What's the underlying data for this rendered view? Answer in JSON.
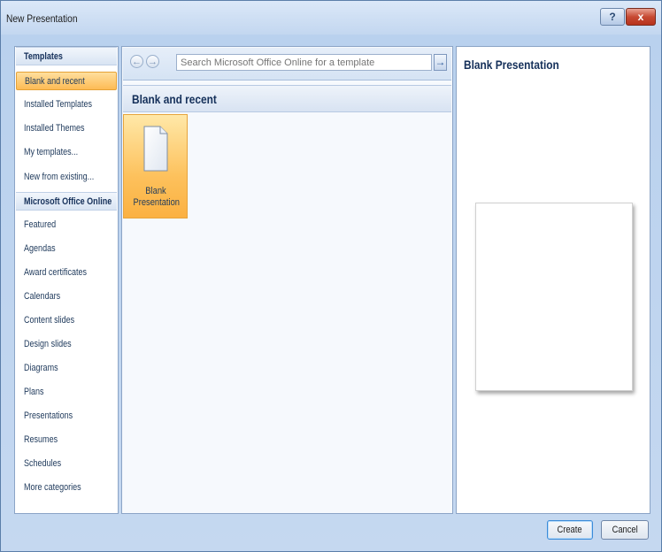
{
  "window": {
    "title": "New Presentation",
    "help_label": "?",
    "close_label": "x"
  },
  "sidebar": {
    "items": [
      {
        "label": "Templates",
        "kind": "header"
      },
      {
        "label": "Blank and recent",
        "kind": "selected"
      },
      {
        "label": "Installed Templates",
        "kind": "item"
      },
      {
        "label": "Installed Themes",
        "kind": "item"
      },
      {
        "label": "My templates...",
        "kind": "item"
      },
      {
        "label": "New from existing...",
        "kind": "item"
      },
      {
        "label": "Microsoft Office Online",
        "kind": "header"
      },
      {
        "label": "Featured",
        "kind": "item"
      },
      {
        "label": "Agendas",
        "kind": "item"
      },
      {
        "label": "Award certificates",
        "kind": "item"
      },
      {
        "label": "Calendars",
        "kind": "item"
      },
      {
        "label": "Content slides",
        "kind": "item"
      },
      {
        "label": "Design slides",
        "kind": "item"
      },
      {
        "label": "Diagrams",
        "kind": "item"
      },
      {
        "label": "Plans",
        "kind": "item"
      },
      {
        "label": "Presentations",
        "kind": "item"
      },
      {
        "label": "Resumes",
        "kind": "item"
      },
      {
        "label": "Schedules",
        "kind": "item"
      },
      {
        "label": "More categories",
        "kind": "item"
      }
    ]
  },
  "toolbar": {
    "back_icon": "back-arrow-icon",
    "forward_icon": "forward-arrow-icon",
    "back_glyph": "←",
    "forward_glyph": "→",
    "search_placeholder": "Search Microsoft Office Online for a template",
    "search_value": "",
    "go_glyph": "→"
  },
  "main": {
    "section_title": "Blank and recent",
    "tile_label": "Blank Presentation"
  },
  "preview": {
    "title": "Blank Presentation"
  },
  "buttons": {
    "create": "Create",
    "cancel": "Cancel"
  },
  "colors": {
    "selection": "#fdbb54",
    "accent": "#15305a",
    "frame": "#c5d8f0"
  }
}
